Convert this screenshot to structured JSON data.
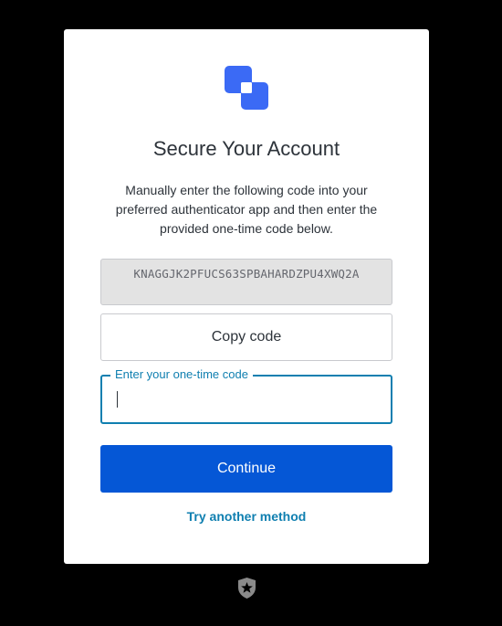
{
  "header": {
    "logo_icon": "brand-stacked-squares-icon",
    "title": "Secure Your Account",
    "description": "Manually enter the following code into your preferred authenticator app and then enter the provided one-time code below."
  },
  "secret": {
    "code": "KNAGGJK2PFUCS63SPBAHARDZPU4XWQ2A",
    "copy_label": "Copy code"
  },
  "otp_field": {
    "label": "Enter your one-time code",
    "value": "",
    "placeholder": ""
  },
  "actions": {
    "continue_label": "Continue",
    "alt_method_label": "Try another method"
  },
  "footer": {
    "logo_icon": "auth0-shield-icon"
  },
  "colors": {
    "background": "#000000",
    "card": "#ffffff",
    "primary_button": "#0557d6",
    "accent": "#0f7fb0",
    "logo_primary": "#3b6af5",
    "text": "#2d333a"
  }
}
